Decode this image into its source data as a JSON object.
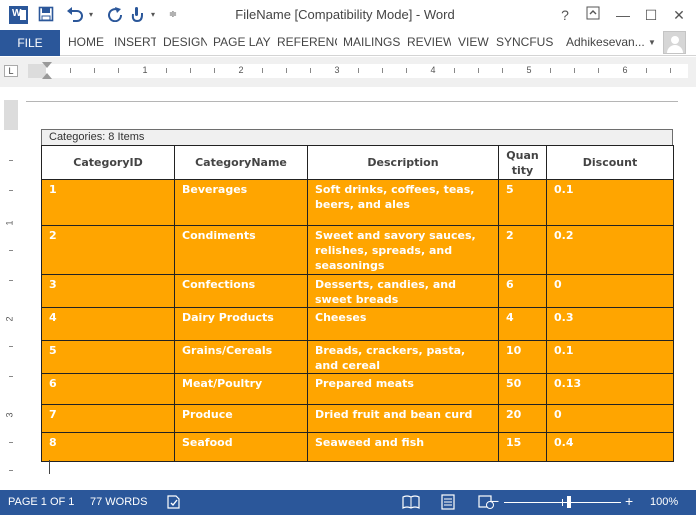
{
  "window": {
    "title": "FileName [Compatibility Mode] - Word",
    "help_label": "?",
    "restore_icon": "ribbon-display-icon",
    "minimize_label": "—",
    "maximize_label": "☐",
    "close_label": "✕"
  },
  "quick_access": {
    "app_icon": "word-icon",
    "app_letter": "W",
    "save_icon": "save-icon",
    "undo_icon": "undo-icon",
    "redo_icon": "redo-icon",
    "touch_icon": "touch-mode-icon",
    "customize_icon": "customize-dropdown-icon"
  },
  "ribbon": {
    "file_label": "FILE",
    "tabs": [
      "HOME",
      "INSERT",
      "DESIGN",
      "PAGE LAY",
      "REFERENC",
      "MAILINGS",
      "REVIEW",
      "VIEW",
      "SYNCFUSI"
    ],
    "user": "Adhikesevan...",
    "avatar_icon": "user-avatar-icon"
  },
  "ruler": {
    "numbers": [
      "1",
      "2",
      "3",
      "4",
      "5",
      "6"
    ],
    "vertical_numbers": [
      "1",
      "2",
      "3"
    ],
    "tab_selector": "L"
  },
  "table": {
    "caption": "Categories: 8 Items",
    "columns": [
      "CategoryID",
      "CategoryName",
      "Description",
      "Quan tity",
      "Discount"
    ],
    "rows": [
      [
        "1",
        "Beverages",
        "Soft drinks, coffees, teas, beers, and ales",
        "5",
        "0.1"
      ],
      [
        "2",
        "Condiments",
        "Sweet and savory sauces, relishes, spreads, and seasonings",
        "2",
        "0.2"
      ],
      [
        "3",
        "Confections",
        "Desserts, candies, and sweet breads",
        "6",
        "0"
      ],
      [
        "4",
        "Dairy Products",
        "Cheeses",
        "4",
        "0.3"
      ],
      [
        "5",
        "Grains/Cereals",
        "Breads, crackers, pasta, and cereal",
        "10",
        "0.1"
      ],
      [
        "6",
        "Meat/Poultry",
        "Prepared meats",
        "50",
        "0.13"
      ],
      [
        "7",
        "Produce",
        "Dried fruit and bean curd",
        "20",
        "0"
      ],
      [
        "8",
        "Seafood",
        "Seaweed and fish",
        "15",
        "0.4"
      ]
    ],
    "row_color": "#FFA500"
  },
  "status": {
    "page": "PAGE 1 OF 1",
    "words": "77 WORDS",
    "proofing_icon": "proofing-icon",
    "read_mode_icon": "read-mode-icon",
    "print_layout_icon": "print-layout-icon",
    "web_layout_icon": "web-layout-icon",
    "zoom_out": "−",
    "zoom_in": "+",
    "zoom": "100%"
  },
  "colors": {
    "accent": "#2B579A"
  }
}
